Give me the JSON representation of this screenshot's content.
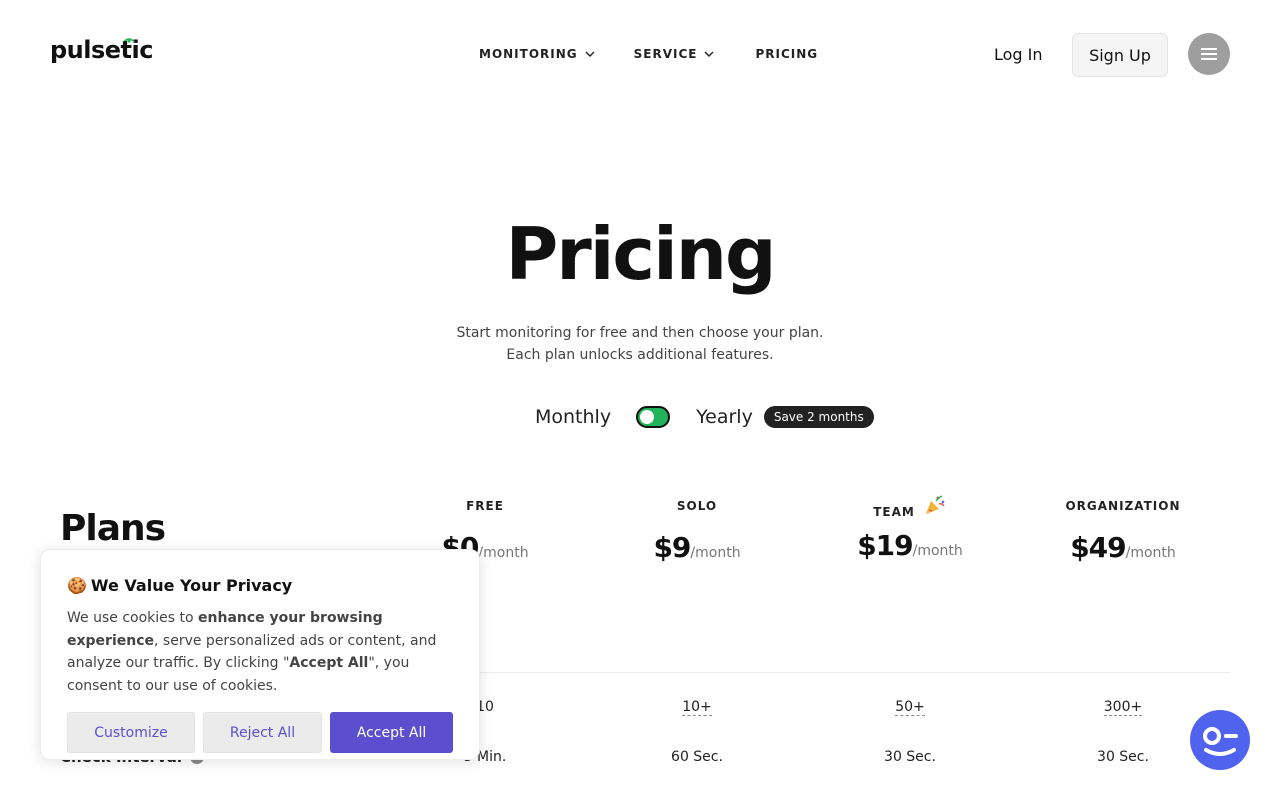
{
  "header": {
    "logo_text": "pulsetic",
    "nav": [
      {
        "label": "MONITORING",
        "has_dropdown": true
      },
      {
        "label": "SERVICE",
        "has_dropdown": true
      },
      {
        "label": "PRICING",
        "has_dropdown": false
      }
    ],
    "login_label": "Log In",
    "signup_label": "Sign Up",
    "menu_icon": "hamburger-icon"
  },
  "hero": {
    "title": "Pricing",
    "subtitle_line1": "Start monitoring for free and then choose your plan.",
    "subtitle_line2": "Each plan unlocks additional features."
  },
  "billing": {
    "monthly_label": "Monthly",
    "yearly_label": "Yearly",
    "save_badge": "Save 2 months",
    "toggle_color": "#20b35a"
  },
  "plans": {
    "heading": "Plans",
    "columns": [
      {
        "name": "FREE",
        "price": "$0",
        "period": "/month",
        "monitors": "10",
        "interval": "5 Min."
      },
      {
        "name": "SOLO",
        "price": "$9",
        "period": "/month",
        "monitors": "10+",
        "interval": "60 Sec."
      },
      {
        "name": "TEAM",
        "price": "$19",
        "period": "/month",
        "monitors": "50+",
        "interval": "30 Sec.",
        "badge_icon": "party-popper-icon"
      },
      {
        "name": "ORGANIZATION",
        "price": "$49",
        "period": "/month",
        "monitors": "300+",
        "interval": "30 Sec."
      }
    ],
    "row_label_interval": "Check Interval"
  },
  "cookie": {
    "title": "We Value Your Privacy",
    "icon": "cookie-icon",
    "text_1": "We use cookies to ",
    "text_bold_1": "enhance your browsing experience",
    "text_2": ", serve personalized ads or content, and analyze our traffic. By clicking \"",
    "text_bold_2": "Accept All",
    "text_3": "\", you consent to our use of cookies.",
    "customize_label": "Customize",
    "reject_label": "Reject All",
    "accept_label": "Accept All",
    "accent_color": "#5b4fcf"
  },
  "chat": {
    "icon": "chat-support-icon",
    "color": "#4f63ee"
  }
}
